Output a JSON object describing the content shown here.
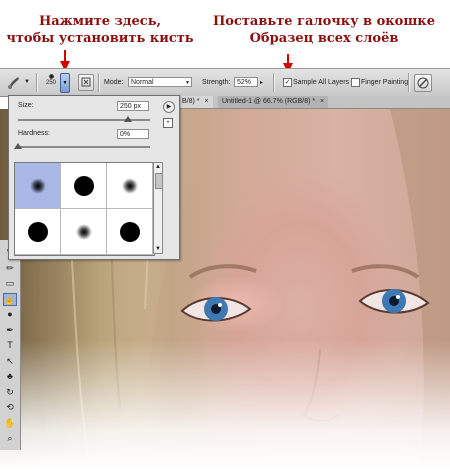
{
  "annotations": {
    "left_line1": "Нажмите здесь,",
    "left_line2": "чтобы установить кисть",
    "right_line1": "Поставьте галочку в окошке",
    "right_line2": "Образец всех слоёв"
  },
  "options_bar": {
    "brush_preview_size": "250",
    "mode_label": "Mode:",
    "mode_value": "Normal",
    "strength_label": "Strength:",
    "strength_value": "52%",
    "sample_all_layers_label": "Sample All Layers",
    "sample_all_layers_checked": true,
    "finger_painting_label": "Finger Painting",
    "finger_painting_checked": false
  },
  "tabs": [
    {
      "label": "B/8) *",
      "close": "×"
    },
    {
      "label": "Untitled-1 @ 66.7% (RGB/8) *",
      "close": "×"
    }
  ],
  "brush_popup": {
    "size_label": "Size:",
    "size_value": "250 px",
    "hardness_label": "Hardness:",
    "hardness_value": "0%",
    "size_fraction": 0.83,
    "hardness_fraction": 0.0,
    "presets": [
      {
        "type": "soft",
        "selected": true
      },
      {
        "type": "hard",
        "selected": false
      },
      {
        "type": "soft",
        "selected": false
      },
      {
        "type": "hard",
        "selected": false
      },
      {
        "type": "soft",
        "selected": false
      },
      {
        "type": "hard",
        "selected": false
      }
    ]
  },
  "tools": [
    {
      "icon": "brush-icon",
      "glyph": "✎"
    },
    {
      "icon": "pencil-icon",
      "glyph": "✏"
    },
    {
      "icon": "gradient-icon",
      "glyph": "▭"
    },
    {
      "icon": "smudge-icon",
      "glyph": "☝"
    },
    {
      "icon": "dodge-icon",
      "glyph": "●"
    },
    {
      "icon": "pen-icon",
      "glyph": "✒"
    },
    {
      "icon": "type-icon",
      "glyph": "T"
    },
    {
      "icon": "path-select-icon",
      "glyph": "↖"
    },
    {
      "icon": "shape-icon",
      "glyph": "♣"
    },
    {
      "icon": "3d-rotate-icon",
      "glyph": "↻"
    },
    {
      "icon": "3d-orbit-icon",
      "glyph": "⟲"
    },
    {
      "icon": "hand-icon",
      "glyph": "✋"
    },
    {
      "icon": "zoom-icon",
      "glyph": "⌕"
    }
  ],
  "colors": {
    "annotation_red": "#8b0f0f",
    "selected_preset": "#aab8e6",
    "arrow_red": "#d40000"
  }
}
